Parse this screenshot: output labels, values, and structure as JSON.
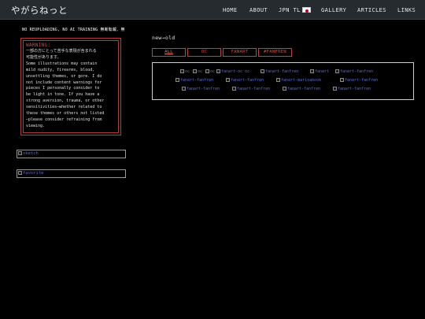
{
  "header": {
    "site_title": "やがらねっと",
    "nav": [
      {
        "id": "home",
        "label": "HOME"
      },
      {
        "id": "about",
        "label": "ABOUT"
      },
      {
        "id": "jpn-tl",
        "label": "JPN TL"
      },
      {
        "id": "gallery",
        "label": "GALLERY"
      },
      {
        "id": "articles",
        "label": "ARTICLES"
      },
      {
        "id": "links",
        "label": "LINKS"
      }
    ]
  },
  "sidebar": {
    "disclaimer": "NO REUPLOADING, NO AI TRAINING 無断転載、無",
    "warning": {
      "title": "WARNING:",
      "lines": [
        "一部の方にとって苦手な表現が含まれる",
        "可能性があります。",
        "Some illustrations may contain",
        "mild nudity, firearms, blood,",
        "unsettling themes, or gore. I do",
        "not include content warnings for",
        "pieces I personally consider to",
        "be light in tone. If you have a",
        "strong aversion, trauma, or other",
        "sensitivities—whether related to",
        "these themes or others not listed",
        "—please consider refraining from",
        "viewing."
      ]
    },
    "links": [
      {
        "id": "sketch",
        "label": "sketch"
      },
      {
        "id": "favorite",
        "label": "favorite"
      }
    ]
  },
  "main": {
    "order_label": "new→old",
    "filters": [
      {
        "id": "all",
        "label": "ALL",
        "active": true
      },
      {
        "id": "oc",
        "label": "OC",
        "active": false
      },
      {
        "id": "fanart",
        "label": "FANART",
        "active": false
      },
      {
        "id": "fanfren",
        "label": "#FANFREN",
        "active": false
      }
    ],
    "gallery_rows": [
      [
        "oc",
        "oc",
        "oc",
        "fanart-oc oc",
        "fanart-fanfren",
        "fanart",
        "fanart-fanfren"
      ],
      [
        "fanart-fanfren",
        "fanart-fanfren",
        "fanart-marisabook",
        "fanart-fanfren"
      ],
      [
        "fanart-fanfren",
        "fanart-fanfren",
        "fanart-fanfren",
        "fanart-fanfren"
      ]
    ]
  }
}
